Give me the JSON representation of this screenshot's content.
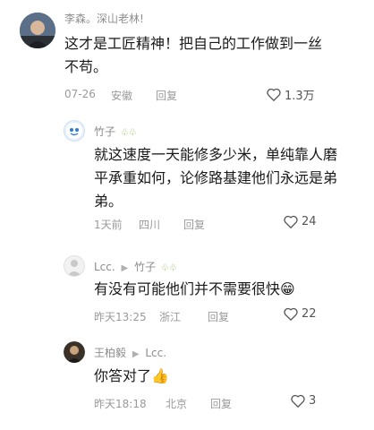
{
  "comments": [
    {
      "user": "李森。深山老林!",
      "text_line1": "这才是工匠精神！把自己的工作做到一丝",
      "text_line2": "不苟。",
      "date": "07-26",
      "location": "安徽",
      "reply_label": "回复",
      "likes": "1.3万"
    },
    {
      "user": "竹子",
      "badges": "♧♧",
      "text_line1": "就这速度一天能修多少米，单纯靠人磨",
      "text_line2": "平承重如何，论修路基建他们永远是弟",
      "text_line3": "弟。",
      "date": "1天前",
      "location": "四川",
      "reply_label": "回复",
      "likes": "24"
    },
    {
      "user": "Lcc.",
      "reply_to": "竹子",
      "badges": "♧♧",
      "text": "有没有可能他们并不需要很快",
      "emoji": "😁",
      "date": "昨天13:25",
      "location": "浙江",
      "reply_label": "回复",
      "likes": "22"
    },
    {
      "user": "王柏毅",
      "reply_to": "Lcc.",
      "text": "你答对了",
      "emoji": "👍",
      "date": "昨天18:18",
      "location": "北京",
      "reply_label": "回复",
      "likes": "3"
    }
  ]
}
